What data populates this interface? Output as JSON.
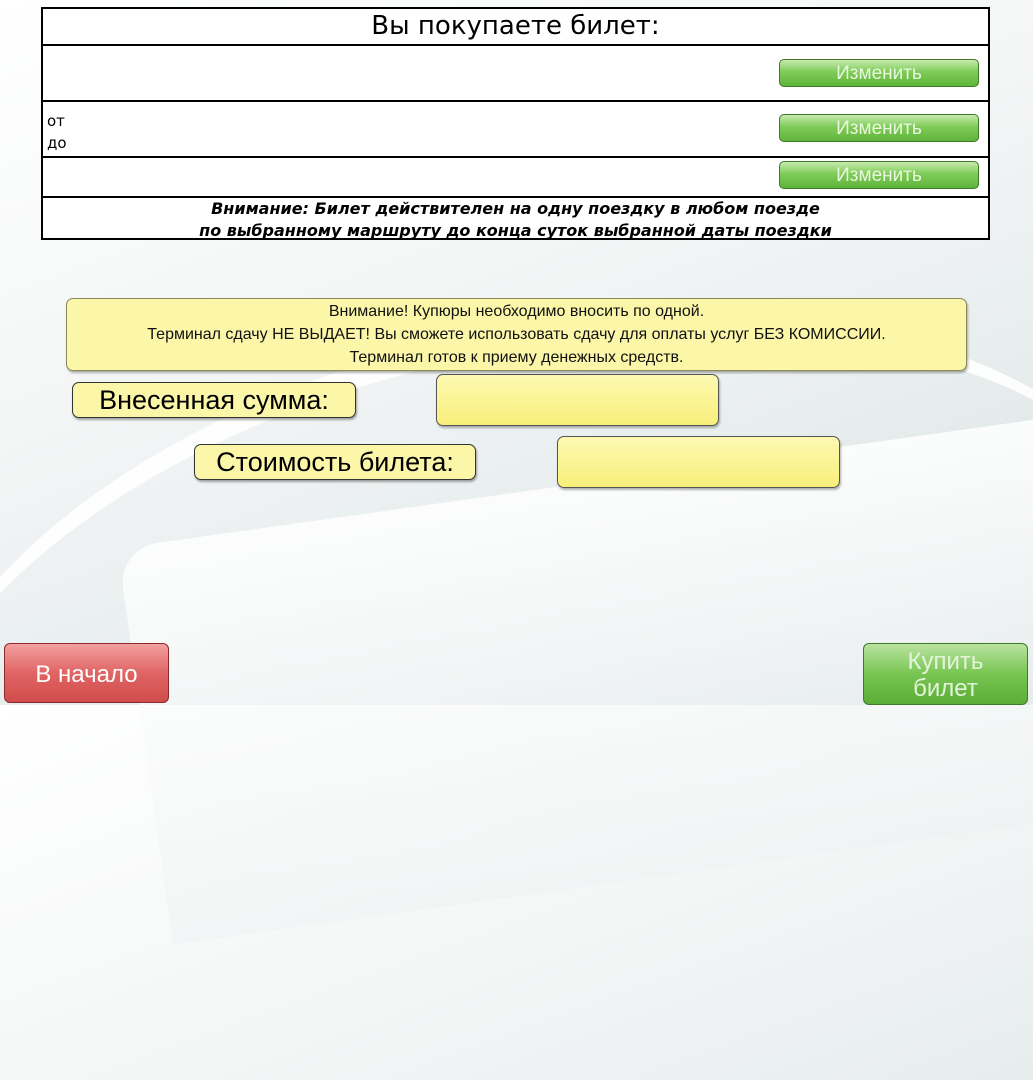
{
  "ticket": {
    "title": "Вы покупаете билет:",
    "from_label": "от",
    "to_label": "до",
    "change_label": "Изменить",
    "warning_line1": "Внимание: Билет действителен на одну поездку в любом поезде",
    "warning_line2": "по выбранному маршруту до конца суток выбранной даты поездки"
  },
  "notice": {
    "line1": "Внимание! Купюры необходимо вносить по одной.",
    "line2": "Терминал сдачу НЕ ВЫДАЕТ! Вы сможете использовать сдачу для оплаты услуг БЕЗ КОМИССИИ.",
    "line3": "Терминал готов к приему денежных средств."
  },
  "payment": {
    "deposited_label": "Внесенная сумма:",
    "deposited_value": "",
    "cost_label": "Стоимость билета:",
    "cost_value": ""
  },
  "nav": {
    "home_label": "В начало",
    "buy_line1": "Купить",
    "buy_line2": "билет"
  },
  "colors": {
    "change_button": "#7fcc58",
    "home_button": "#e06464",
    "buy_button": "#78c652",
    "notice_bg": "#fbf6a8"
  }
}
